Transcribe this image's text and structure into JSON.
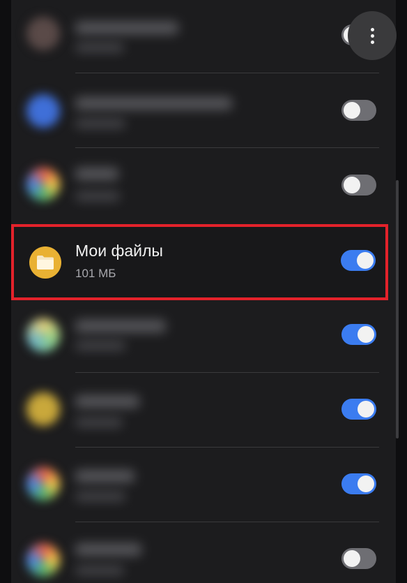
{
  "app_list": {
    "highlighted_app": {
      "name": "Мои файлы",
      "size": "101 МБ",
      "enabled": true
    },
    "rows": [
      {
        "icon": "app-icon",
        "enabled": false
      },
      {
        "icon": "app-icon",
        "enabled": false
      },
      {
        "icon": "app-icon",
        "enabled": false
      },
      {
        "icon": "folder-icon",
        "enabled": true
      },
      {
        "icon": "app-icon",
        "enabled": true
      },
      {
        "icon": "app-icon",
        "enabled": true
      },
      {
        "icon": "app-icon",
        "enabled": true
      },
      {
        "icon": "app-icon",
        "enabled": false
      }
    ]
  },
  "colors": {
    "background": "#1c1c1e",
    "toggle_on": "#3b7cf0",
    "toggle_off": "#6e6e73",
    "highlight_border": "#e3222b",
    "folder_icon": "#e9b133"
  },
  "more_options_icon": "more-vertical-icon"
}
